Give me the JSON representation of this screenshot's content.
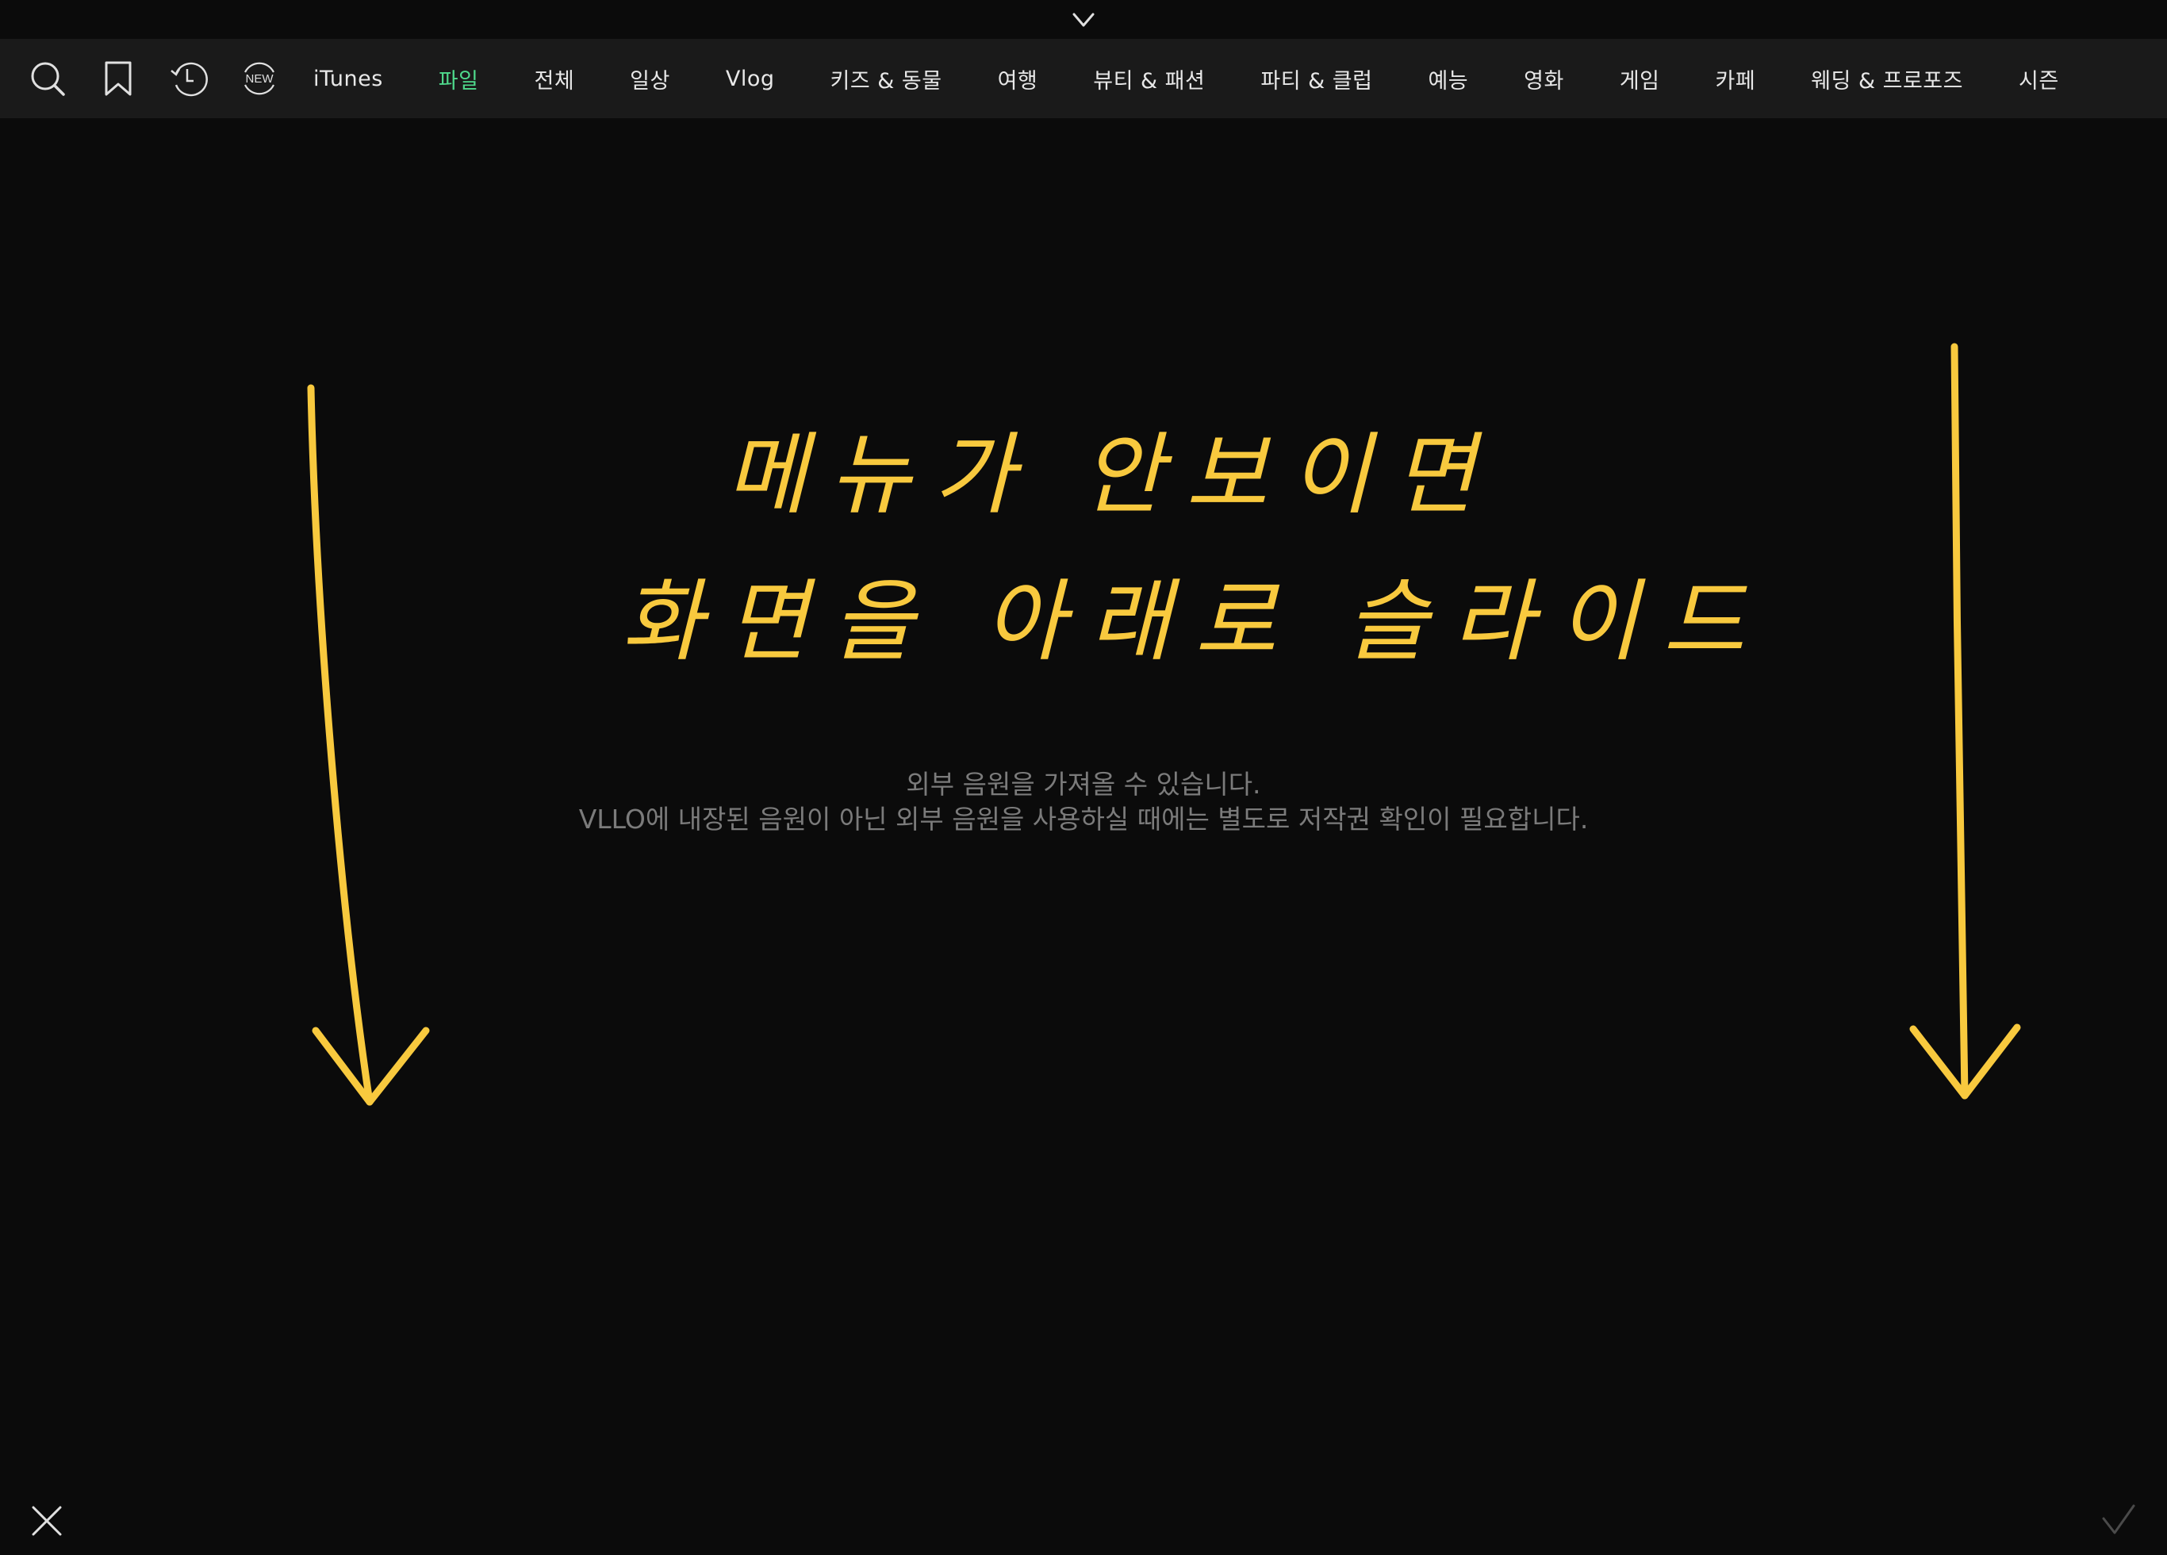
{
  "top_handle": {
    "icon": "chevron-down-icon"
  },
  "nav": {
    "icons": [
      {
        "name": "search-icon"
      },
      {
        "name": "bookmark-icon"
      },
      {
        "name": "recent-icon"
      },
      {
        "name": "new-icon",
        "label": "NEW"
      }
    ],
    "tabs": [
      {
        "label": "iTunes"
      },
      {
        "label": "파일"
      },
      {
        "label": "전체"
      },
      {
        "label": "일상"
      },
      {
        "label": "Vlog"
      },
      {
        "label": "키즈 & 동물"
      },
      {
        "label": "여행"
      },
      {
        "label": "뷰티 & 패션"
      },
      {
        "label": "파티 & 클럽"
      },
      {
        "label": "예능"
      },
      {
        "label": "영화"
      },
      {
        "label": "게임"
      },
      {
        "label": "카페"
      },
      {
        "label": "웨딩 & 프로포즈"
      },
      {
        "label": "시즌"
      }
    ],
    "active_tab": "파일"
  },
  "annotation": {
    "line1": "메뉴가 안보이면",
    "line2": "화면을 아래로 슬라이드",
    "color": "#f8c93e"
  },
  "info": {
    "line1": "외부 음원을 가져올 수 있습니다.",
    "line2": "VLLO에 내장된 음원이 아닌 외부 음원을 사용하실 때에는 별도로 저작권 확인이 필요합니다."
  },
  "footer": {
    "close_icon": "close-icon",
    "confirm_icon": "checkmark-icon"
  },
  "colors": {
    "background": "#0b0b0b",
    "navbar": "#1a1a1a",
    "active_tab": "#4fd98c",
    "info_text": "#7b7b7b"
  }
}
